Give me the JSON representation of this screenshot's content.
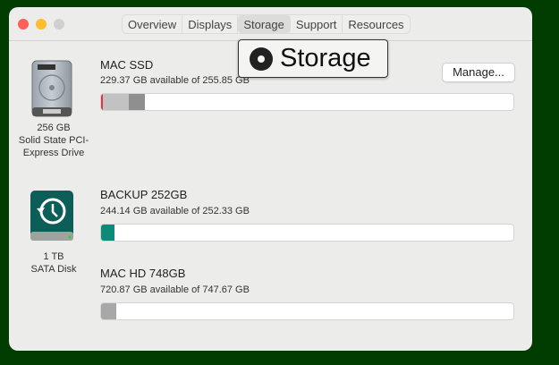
{
  "window": {
    "tabs": [
      "Overview",
      "Displays",
      "Storage",
      "Support",
      "Resources"
    ],
    "active_tab": "Storage"
  },
  "tooltip": {
    "label": "Storage"
  },
  "manage_button": "Manage...",
  "drives": [
    {
      "name": "MAC SSD",
      "available": "229.37 GB available of 255.85 GB",
      "caption": [
        "256 GB",
        "Solid State PCI-",
        "Express Drive"
      ],
      "used_fraction": 0.104,
      "segments": [
        {
          "color": "#e0334a",
          "fraction": 0.004
        },
        {
          "color": "#c2c2c2",
          "fraction": 0.063
        },
        {
          "color": "#8f8f8f",
          "fraction": 0.04
        }
      ]
    },
    {
      "name": "BACKUP 252GB",
      "available": "244.14 GB available of 252.33 GB",
      "caption": [
        "1 TB",
        "SATA Disk"
      ],
      "used_fraction": 0.032,
      "segments": [
        {
          "color": "#0e8a7b",
          "fraction": 0.032
        }
      ]
    },
    {
      "name": "MAC HD 748GB",
      "available": "720.87 GB available of 747.67 GB",
      "used_fraction": 0.036,
      "segments": [
        {
          "color": "#a8a8a8",
          "fraction": 0.036
        }
      ]
    }
  ]
}
